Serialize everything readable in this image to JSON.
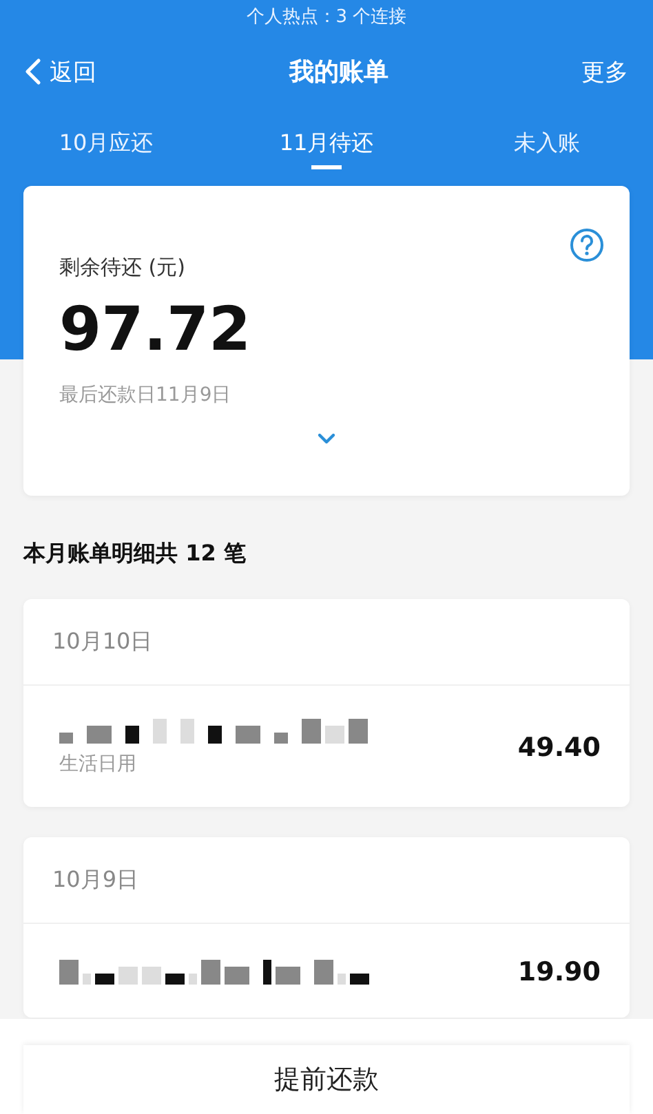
{
  "status_bar": {
    "text": "个人热点：3 个连接"
  },
  "nav": {
    "back": "返回",
    "title": "我的账单",
    "more": "更多"
  },
  "tabs": [
    {
      "label": "10月应还",
      "selected": false
    },
    {
      "label": "11月待还",
      "selected": true
    },
    {
      "label": "未入账",
      "selected": false
    }
  ],
  "summary": {
    "label": "剩余待还 (元)",
    "amount": "97.72",
    "due": "最后还款日11月9日"
  },
  "section_title": "本月账单明细共 12 笔",
  "groups": [
    {
      "date": "10月10日",
      "items": [
        {
          "category": "生活日用",
          "amount": "49.40"
        }
      ]
    },
    {
      "date": "10月9日",
      "items": [
        {
          "amount": "19.90"
        }
      ]
    }
  ],
  "footer_button": "提前还款"
}
